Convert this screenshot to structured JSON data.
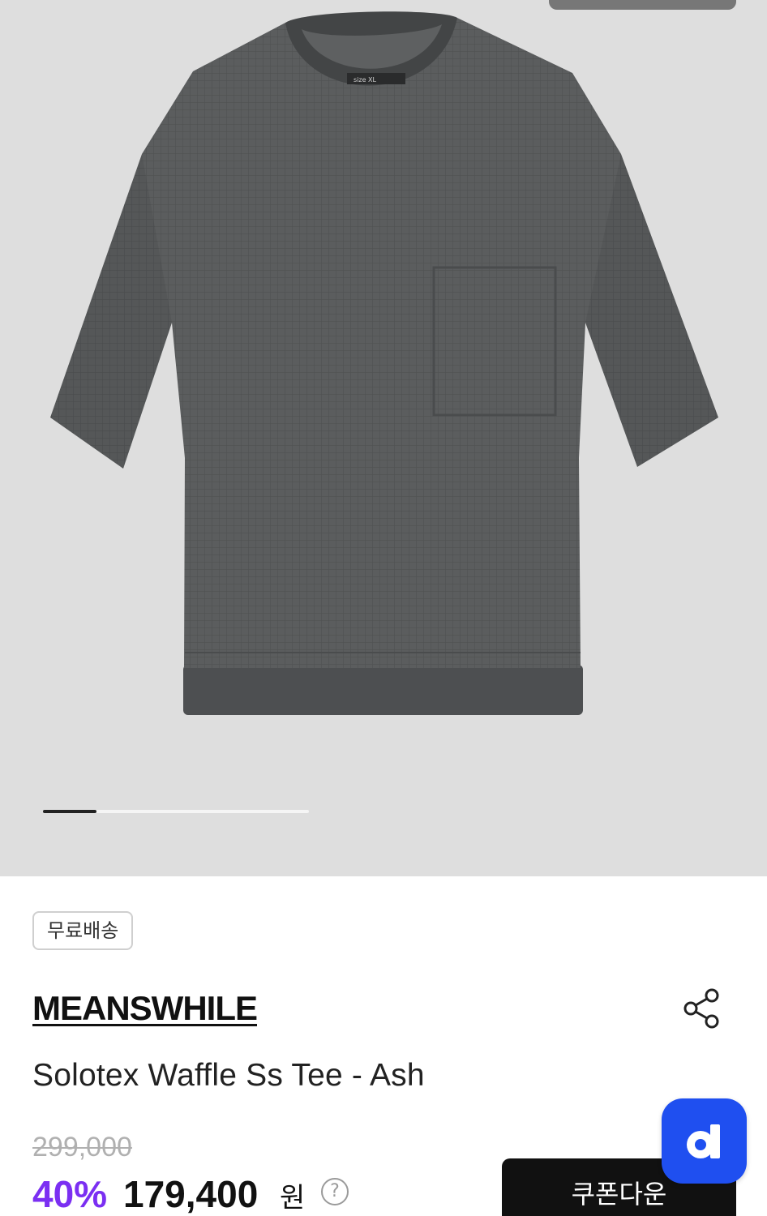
{
  "product": {
    "badge": "무료배송",
    "brand": "MEANSWHILE",
    "name": "Solotex Waffle Ss Tee - Ash",
    "original_price": "299,000",
    "discount": "40%",
    "sale_price": "179,400",
    "currency": "원"
  },
  "actions": {
    "coupon_label": "쿠폰다운",
    "help_glyph": "?"
  },
  "gallery": {
    "progress_fraction": 0.2,
    "label_text": "size  XL"
  },
  "icons": {
    "share": "share-icon",
    "help": "question-circle-icon",
    "app": "d-logo-icon"
  },
  "colors": {
    "accent_purple": "#7b2ff2",
    "fab_blue": "#1f4ff0",
    "button_black": "#111111",
    "hero_bg": "#dedede",
    "garment": "#5a5c5d"
  }
}
